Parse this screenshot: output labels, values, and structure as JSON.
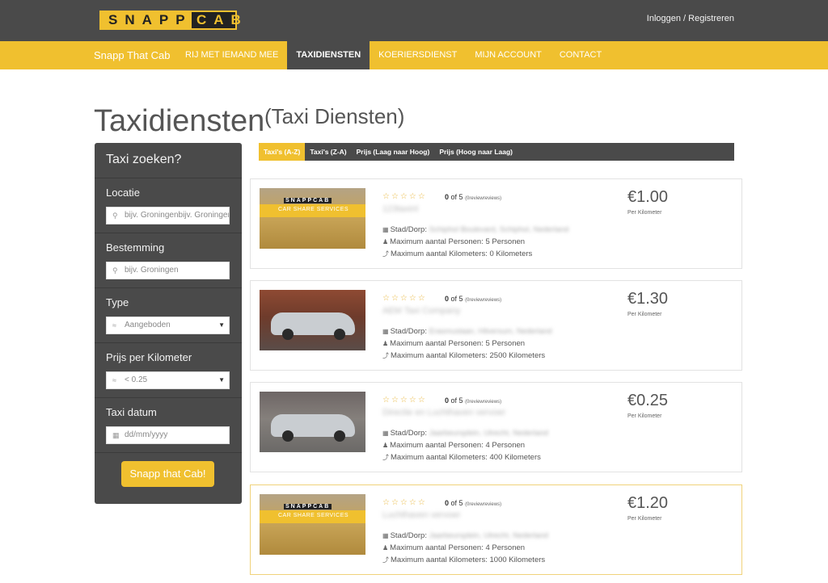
{
  "header": {
    "logo_left": "SNAPP",
    "logo_right": "CAB",
    "login": "Inloggen / Registreren"
  },
  "nav": {
    "brand": "Snapp That Cab",
    "items": [
      {
        "label": "RIJ MET IEMAND MEE",
        "active": false
      },
      {
        "label": "TAXIDIENSTEN",
        "active": true
      },
      {
        "label": "KOERIERSDIENST",
        "active": false
      },
      {
        "label": "MIJN ACCOUNT",
        "active": false
      },
      {
        "label": "CONTACT",
        "active": false
      }
    ]
  },
  "page": {
    "title": "Taxidiensten",
    "subtitle": "(Taxi Diensten)"
  },
  "sidebar": {
    "heading": "Taxi zoeken?",
    "location_label": "Locatie",
    "location_placeholder": "bijv. Groningenbijv. Groningen",
    "destination_label": "Bestemming",
    "destination_placeholder": "bijv. Groningen",
    "type_label": "Type",
    "type_value": "Aangeboden",
    "price_label": "Prijs per Kilometer",
    "price_value": "< 0.25",
    "date_label": "Taxi datum",
    "date_placeholder": "dd/mm/yyyy",
    "button": "Snapp that Cab!"
  },
  "sort": {
    "tabs": [
      "Taxi's (A-Z)",
      "Taxi's (Z-A)",
      "Prijs (Laag naar Hoog)",
      "Prijs (Hoog naar Laag)"
    ],
    "active_index": 0
  },
  "listing_common": {
    "stars": "☆☆☆☆☆",
    "rating_value": "0",
    "rating_of": "of 5",
    "reviews": "(0reviewreviews)",
    "city_label": "Stad/Dorp:",
    "persons_label": "Maximum aantal Personen:",
    "km_label": "Maximum aantal Kilometers:",
    "per_km": "Per Kilometer"
  },
  "listings": [
    {
      "name": "123taxinl",
      "city": "Schiphol Boulevard, Schiphol, Nederland",
      "persons": "5 Personen",
      "km": "0 Kilometers",
      "price": "€1.00",
      "thumb": "brand"
    },
    {
      "name": "AEM Taxi Company",
      "city": "Erasmuslaan, Hilversum, Nederland",
      "persons": "5 Personen",
      "km": "2500 Kilometers",
      "price": "€1.30",
      "thumb": "car1"
    },
    {
      "name": "Directie en Luchthaven vervoer",
      "city": "Jaarbeursplein, Utrecht, Nederland",
      "persons": "4 Personen",
      "km": "400 Kilometers",
      "price": "€0.25",
      "thumb": "car2"
    },
    {
      "name": "Luchthaven vervoer",
      "city": "Jaarbeursplein, Utrecht, Nederland",
      "persons": "4 Personen",
      "km": "1000 Kilometers",
      "price": "€1.20",
      "thumb": "brand"
    }
  ],
  "thumb_brand": {
    "logo": "SNAPPCAB",
    "sub": "CAR SHARE SERVICES"
  }
}
